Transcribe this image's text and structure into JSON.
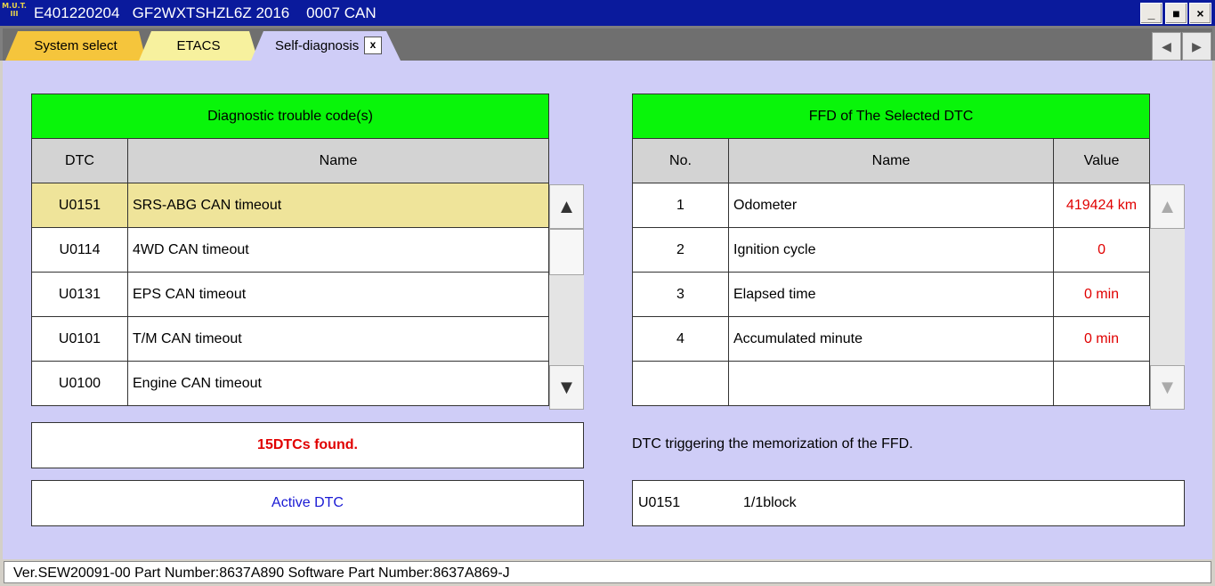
{
  "window": {
    "logo_text": "M.U.T. III",
    "title": "E401220204   GF2WXTSHZL6Z 2016    0007 CAN",
    "minimize": "_",
    "maximize": "■",
    "close": "×"
  },
  "tabs": {
    "items": [
      {
        "label": "System select"
      },
      {
        "label": "ETACS"
      },
      {
        "label": "Self-diagnosis"
      }
    ],
    "close_label": "x",
    "prev": "◀",
    "next": "▶"
  },
  "dtc_table": {
    "title": "Diagnostic trouble code(s)",
    "col_dtc": "DTC",
    "col_name": "Name",
    "rows": [
      {
        "code": "U0151",
        "name": "SRS-ABG CAN timeout"
      },
      {
        "code": "U0114",
        "name": "4WD CAN timeout"
      },
      {
        "code": "U0131",
        "name": "EPS CAN timeout"
      },
      {
        "code": "U0101",
        "name": "T/M CAN timeout"
      },
      {
        "code": "U0100",
        "name": "Engine CAN timeout"
      }
    ],
    "selected_index": 0,
    "found": "15DTCs found.",
    "active_button": "Active DTC"
  },
  "ffd_table": {
    "title": "FFD of The Selected DTC",
    "col_no": "No.",
    "col_name": "Name",
    "col_value": "Value",
    "rows": [
      {
        "no": "1",
        "name": "Odometer",
        "value": "419424 km"
      },
      {
        "no": "2",
        "name": "Ignition cycle",
        "value": "0"
      },
      {
        "no": "3",
        "name": "Elapsed time",
        "value": "0 min"
      },
      {
        "no": "4",
        "name": "Accumulated minute",
        "value": "0 min"
      },
      {
        "no": "",
        "name": "",
        "value": ""
      }
    ],
    "trigger_label": "DTC triggering the memorization of the FFD.",
    "trigger_code": "U0151",
    "trigger_block": "1/1block"
  },
  "scroll": {
    "up": "▲",
    "down": "▼"
  },
  "status": {
    "text": "Ver.SEW20091-00 Part Number:8637A890   Software Part Number:8637A869-J"
  },
  "colors": {
    "title_bar": "#0a1a9c",
    "header_green": "#09f50a",
    "panel_bg": "#cfcdf7",
    "selected_row": "#efe49a",
    "value_red": "#e00000",
    "active_dtc_blue": "#1a1ad4"
  }
}
